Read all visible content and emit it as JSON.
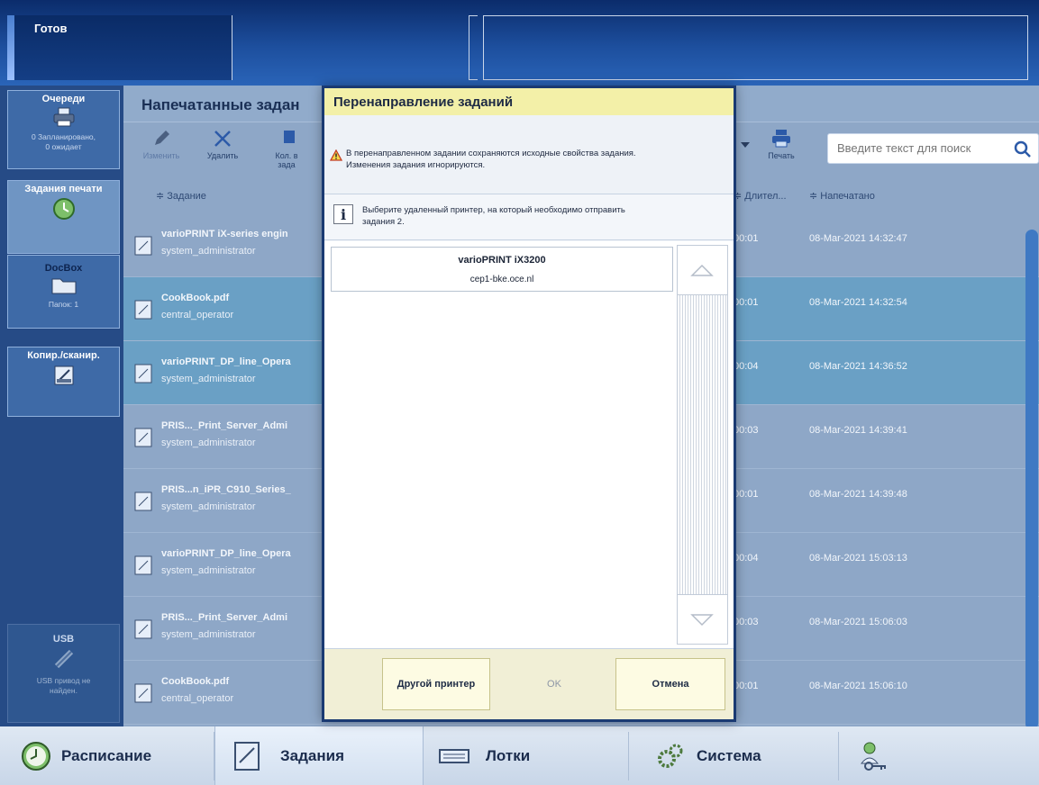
{
  "status": {
    "text": "Готов"
  },
  "sidebar": {
    "queues": {
      "title": "Очереди",
      "line1": "0 Запланировано,",
      "line2": "0 ожидает"
    },
    "print_jobs": {
      "title": "Задания печати"
    },
    "docbox": {
      "title": "DocBox",
      "sub": "Папок: 1"
    },
    "copy_scan": {
      "title": "Копир./сканир."
    },
    "usb": {
      "title": "USB",
      "line1": "USB привод не",
      "line2": "найден."
    }
  },
  "main": {
    "title": "Напечатанные задан",
    "toolbar": {
      "edit": "Изменить",
      "delete": "Удалить",
      "copies_line1": "Кол. в",
      "copies_line2": "зада",
      "print": "Печать"
    },
    "search": {
      "placeholder": "Введите текст для поиск"
    },
    "columns": {
      "job": "≑ Задание",
      "duration": "≑ Длител...",
      "printed": "≑ Напечатано"
    },
    "rows": [
      {
        "name": "varioPRINT iX-series engin",
        "owner": "system_administrator",
        "duration": "00:01",
        "printed": "08-Mar-2021 14:32:47"
      },
      {
        "name": "CookBook.pdf",
        "owner": "central_operator",
        "duration": "00:01",
        "printed": "08-Mar-2021 14:32:54"
      },
      {
        "name": "varioPRINT_DP_line_Opera",
        "owner": "system_administrator",
        "duration": "00:04",
        "printed": "08-Mar-2021 14:36:52"
      },
      {
        "name": "PRIS..._Print_Server_Admi",
        "owner": "system_administrator",
        "duration": "00:03",
        "printed": "08-Mar-2021 14:39:41"
      },
      {
        "name": "PRIS...n_iPR_C910_Series_",
        "owner": "system_administrator",
        "duration": "00:01",
        "printed": "08-Mar-2021 14:39:48"
      },
      {
        "name": "varioPRINT_DP_line_Opera",
        "owner": "system_administrator",
        "duration": "00:04",
        "printed": "08-Mar-2021 15:03:13"
      },
      {
        "name": "PRIS..._Print_Server_Admi",
        "owner": "system_administrator",
        "duration": "00:03",
        "printed": "08-Mar-2021 15:06:03"
      },
      {
        "name": "CookBook.pdf",
        "owner": "central_operator",
        "duration": "00:01",
        "printed": "08-Mar-2021 15:06:10"
      }
    ]
  },
  "dialog": {
    "title": "Перенаправление заданий",
    "warning_line1": "В перенаправленном задании сохраняются исходные свойства задания.",
    "warning_line2": "Изменения задания игнорируются.",
    "info_line1": "Выберите удаленный принтер, на который необходимо отправить",
    "info_line2": "задания 2.",
    "printer": {
      "name": "varioPRINT iX3200",
      "host": "cep1-bke.oce.nl"
    },
    "buttons": {
      "other_printer": "Другой принтер",
      "ok": "OK",
      "cancel": "Отмена"
    }
  },
  "bottom_nav": {
    "schedule": "Расписание",
    "jobs": "Задания",
    "trays": "Лотки",
    "system": "Система"
  }
}
